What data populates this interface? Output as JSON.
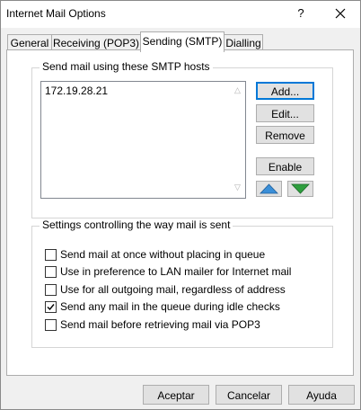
{
  "window": {
    "title": "Internet Mail Options",
    "help_label": "?"
  },
  "tabs": [
    {
      "label": "General"
    },
    {
      "label": "Receiving (POP3)"
    },
    {
      "label": "Sending (SMTP)"
    },
    {
      "label": "Dialling"
    }
  ],
  "active_tab": "Sending (SMTP)",
  "smtp": {
    "group_label": "Send mail using these SMTP hosts",
    "hosts": [
      "172.19.28.21"
    ],
    "buttons": {
      "add": "Add...",
      "edit": "Edit...",
      "remove": "Remove",
      "enable": "Enable"
    }
  },
  "settings": {
    "group_label": "Settings controlling the way mail is sent",
    "options": [
      {
        "label": "Send mail at once without placing in queue",
        "checked": false
      },
      {
        "label": "Use in preference to LAN mailer for Internet mail",
        "checked": false
      },
      {
        "label": "Use for all outgoing mail, regardless of address",
        "checked": false
      },
      {
        "label": "Send any mail in the queue during idle checks",
        "checked": true
      },
      {
        "label": "Send mail before retrieving mail via POP3",
        "checked": false
      }
    ]
  },
  "footer": {
    "ok": "Aceptar",
    "cancel": "Cancelar",
    "help": "Ayuda"
  },
  "colors": {
    "accent": "#0078d7",
    "arrow_up": "#3a8fd8",
    "arrow_down": "#2e9e3e"
  }
}
